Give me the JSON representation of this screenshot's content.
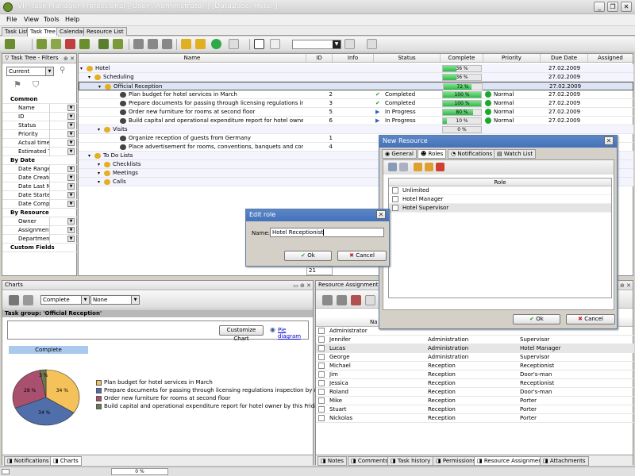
{
  "window": {
    "title": "VIP Task Manager Professional [ User : Administrator ] [DataBase: Hotel ]"
  },
  "menu": [
    "File",
    "View",
    "Tools",
    "Help"
  ],
  "main_tabs": [
    "Task List",
    "Task Tree",
    "Calendar",
    "Resource List"
  ],
  "filters": {
    "title": "Task Tree - Filters",
    "current": "Current",
    "sections": [
      {
        "title": "Common",
        "fields": [
          "Name",
          "ID",
          "Status",
          "Priority",
          "Actual time",
          "Estimated Ti"
        ]
      },
      {
        "title": "By Date",
        "fields": [
          "Date Range",
          "Date Create",
          "Date Last M",
          "Date Startec",
          "Date Compl"
        ]
      },
      {
        "title": "By Resource",
        "fields": [
          "Owner",
          "Assignment",
          "Department"
        ]
      },
      {
        "title": "Custom Fields",
        "fields": []
      }
    ]
  },
  "grid": {
    "columns": [
      "Name",
      "ID",
      "Info",
      "Status",
      "Complete",
      "Priority",
      "Due Date",
      "Assigned"
    ],
    "rows": [
      {
        "level": 0,
        "name": "Hotel",
        "group": true,
        "complete": 36,
        "complete_label": "36 %",
        "due": "27.02.2009"
      },
      {
        "level": 1,
        "name": "Scheduling",
        "group": true,
        "complete": 36,
        "complete_label": "36 %",
        "due": "27.02.2009"
      },
      {
        "level": 2,
        "name": "Official Reception",
        "group": true,
        "selected": true,
        "complete": 72,
        "complete_label": "72 %",
        "due": "27.02.2009"
      },
      {
        "level": 3,
        "name": "Plan budget for hotel services in March",
        "id": "2",
        "status": "Completed",
        "status_icon": "check-icon",
        "complete": 100,
        "complete_label": "100 %",
        "priority": "Normal",
        "due": "27.02.2009"
      },
      {
        "level": 3,
        "name": "Prepare documents for passing through licensing regulations inspection by n",
        "id": "3",
        "status": "Completed",
        "status_icon": "check-icon",
        "complete": 100,
        "complete_label": "100 %",
        "priority": "Normal",
        "due": "27.02.2009"
      },
      {
        "level": 3,
        "name": "Order new furniture for rooms at second floor",
        "id": "5",
        "status": "In Progress",
        "status_icon": "flag-icon",
        "complete": 80,
        "complete_label": "80 %",
        "priority": "Normal",
        "due": "27.02.2009"
      },
      {
        "level": 3,
        "name": "Build capital and operational expenditure report for hotel owner by this Fric",
        "id": "6",
        "status": "In Progress",
        "status_icon": "flag-icon",
        "complete": 10,
        "complete_label": "10 %",
        "priority": "Normal",
        "due": "27.02.2009"
      },
      {
        "level": 2,
        "name": "Visits",
        "group": true,
        "complete_label": "0 %"
      },
      {
        "level": 3,
        "name": "Organize reception of guests from Germany",
        "id": "1"
      },
      {
        "level": 3,
        "name": "Place advertisement for rooms, conventions, banquets and conferences in",
        "id": "4"
      },
      {
        "level": 1,
        "name": "To Do Lists",
        "group": true
      },
      {
        "level": 2,
        "name": "Checklists",
        "group": true
      },
      {
        "level": 2,
        "name": "Meetings",
        "group": true
      },
      {
        "level": 2,
        "name": "Calls",
        "group": true
      }
    ],
    "footer_value": "21"
  },
  "charts": {
    "title": "Charts",
    "complete_select": "Complete",
    "none_select": "None",
    "group_label": "Task group: 'Official Reception'",
    "customize": "Customize Chart",
    "pie_link": "Pie diagram",
    "bar_label": "Complete"
  },
  "chart_data": {
    "type": "pie",
    "title": "Task group: 'Official Reception'",
    "slices": [
      {
        "label": "Plan budget for hotel services in March",
        "value": 34,
        "text": "34 %",
        "color": "#f5c15a"
      },
      {
        "label": "Prepare documents for passing through licensing regulations inspection by next Monday",
        "value": 34,
        "text": "34 %",
        "color": "#4f6eaa"
      },
      {
        "label": "Order new furniture for rooms at second floor",
        "value": 28,
        "text": "28 %",
        "color": "#a8506e"
      },
      {
        "label": "Build capital and operational expenditure report for hotel owner by this Friday",
        "value": 3,
        "text": "3 %",
        "color": "#6a7a4e"
      }
    ]
  },
  "left_tabs": [
    "Notifications",
    "Charts"
  ],
  "resource": {
    "title": "Resource Assignment",
    "col_name": "Na",
    "rows": [
      {
        "name": "Administrator",
        "dept": "",
        "role": ""
      },
      {
        "name": "Jennifer",
        "dept": "Administration",
        "role": "Supervisor"
      },
      {
        "name": "Lucas",
        "dept": "Administration",
        "role": "Hotel Manager"
      },
      {
        "name": "George",
        "dept": "Administration",
        "role": "Supervisor"
      },
      {
        "name": "Michael",
        "dept": "Reception",
        "role": "Receptionist"
      },
      {
        "name": "Jim",
        "dept": "Reception",
        "role": "Door's-man"
      },
      {
        "name": "Jessica",
        "dept": "Reception",
        "role": "Receptionist"
      },
      {
        "name": "Roland",
        "dept": "Reception",
        "role": "Door's-man"
      },
      {
        "name": "Mike",
        "dept": "Reception",
        "role": "Porter"
      },
      {
        "name": "Stuart",
        "dept": "Reception",
        "role": "Porter"
      },
      {
        "name": "Nickolas",
        "dept": "Reception",
        "role": "Porter"
      }
    ]
  },
  "right_tabs": [
    "Notes",
    "Comments",
    "Task history",
    "Permissions",
    "Resource Assignment",
    "Attachments"
  ],
  "new_resource": {
    "title": "New Resource",
    "tabs": [
      "General",
      "Roles",
      "Notifications",
      "Watch List"
    ],
    "col_role": "Role",
    "roles": [
      {
        "name": "Unlimited",
        "checked": false
      },
      {
        "name": "Hotel Manager",
        "checked": false
      },
      {
        "name": "Hotel Supervisor",
        "checked": false
      }
    ],
    "ok": "Ok",
    "cancel": "Cancel"
  },
  "edit_role": {
    "title": "Edit role",
    "name_label": "Name:",
    "name_value": "Hotel Receptionist",
    "ok": "Ok",
    "cancel": "Cancel"
  },
  "statusbar": {
    "progress": "0 %"
  }
}
